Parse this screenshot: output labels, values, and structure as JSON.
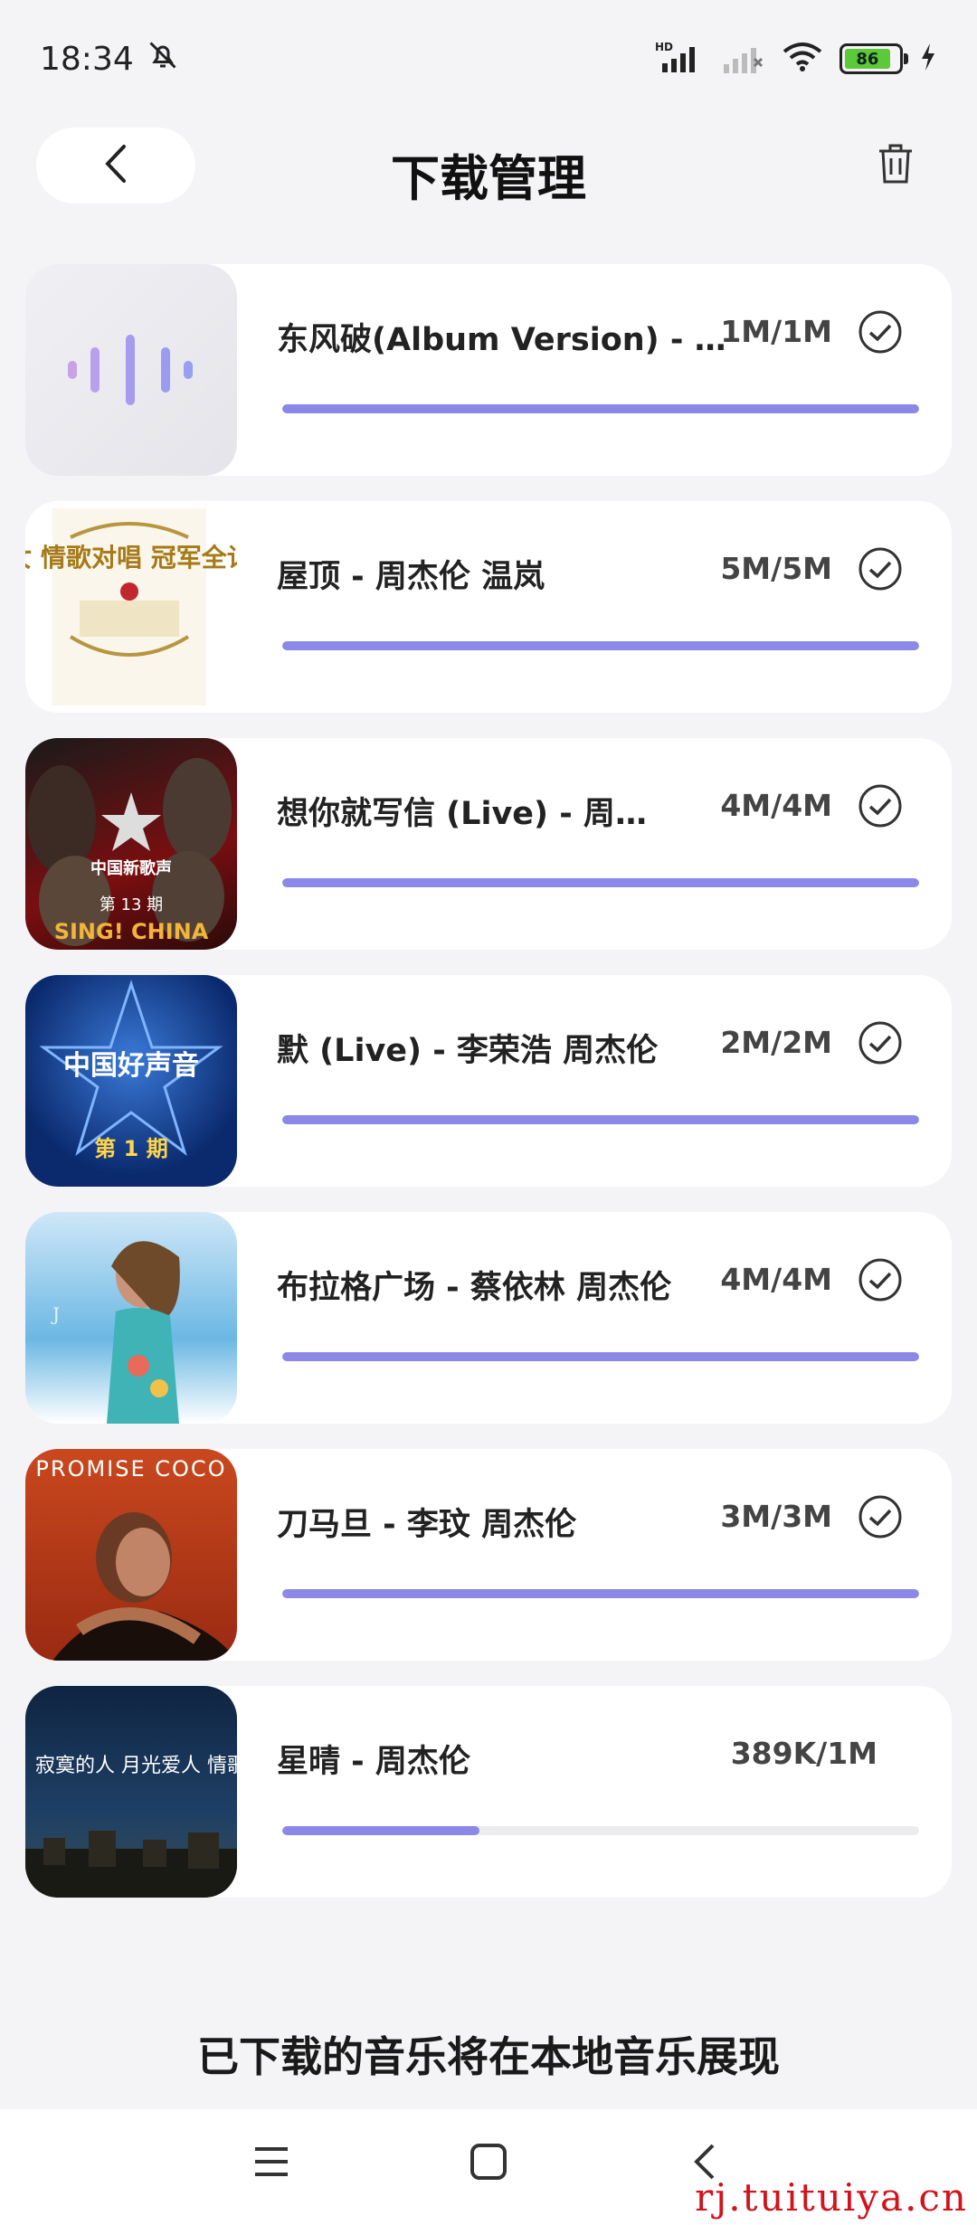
{
  "status_bar": {
    "time": "18:34",
    "battery": "86",
    "icons": [
      "silent-bell-icon",
      "hd-signal-icon",
      "no-signal-icon",
      "wifi-icon",
      "battery-icon",
      "charging-icon"
    ]
  },
  "header": {
    "title": "下载管理",
    "back_icon": "chevron-left-icon",
    "trash_icon": "trash-icon"
  },
  "downloads": [
    {
      "title": "东风破(Album Version) - 周杰伦",
      "size": "1M/1M",
      "progress": 1.0,
      "done": true,
      "cover": "voice-wave-placeholder"
    },
    {
      "title": "屋顶 - 周杰伦 温岚",
      "size": "5M/5M",
      "progress": 1.0,
      "done": true,
      "cover": "album-cover"
    },
    {
      "title": "想你就写信 (Live) - 周杰伦 汪峰",
      "size": "4M/4M",
      "progress": 1.0,
      "done": true,
      "cover": "album-cover"
    },
    {
      "title": "默 (Live) - 李荣浩 周杰伦",
      "size": "2M/2M",
      "progress": 1.0,
      "done": true,
      "cover": "album-cover"
    },
    {
      "title": "布拉格广场 - 蔡依林 周杰伦",
      "size": "4M/4M",
      "progress": 1.0,
      "done": true,
      "cover": "album-cover"
    },
    {
      "title": "刀马旦 - 李玟 周杰伦",
      "size": "3M/3M",
      "progress": 1.0,
      "done": true,
      "cover": "album-cover"
    },
    {
      "title": "星晴 - 周杰伦",
      "size": "389K/1M",
      "progress": 0.31,
      "done": false,
      "cover": "album-cover"
    }
  ],
  "cover_texts": {
    "item1": "男女 情歌对唱 冠军全记录",
    "item2a": "中国新歌声",
    "item2b": "第 13 期",
    "item2c": "SING! CHINA",
    "item3a": "中国好声音",
    "item3b": "第 1 期",
    "item5": "PROMISE COCO",
    "item6": "寂寞的人 月光爱人 情歌精选"
  },
  "footer_note": "已下载的音乐将在本地音乐展现",
  "nav_bar": {
    "icons": [
      "menu-icon",
      "home-square-icon",
      "back-icon"
    ],
    "watermark": "rj.tuituiya.cn"
  },
  "colors": {
    "accent": "#8b88e8",
    "background": "#f4f4f6",
    "card": "#ffffff"
  }
}
